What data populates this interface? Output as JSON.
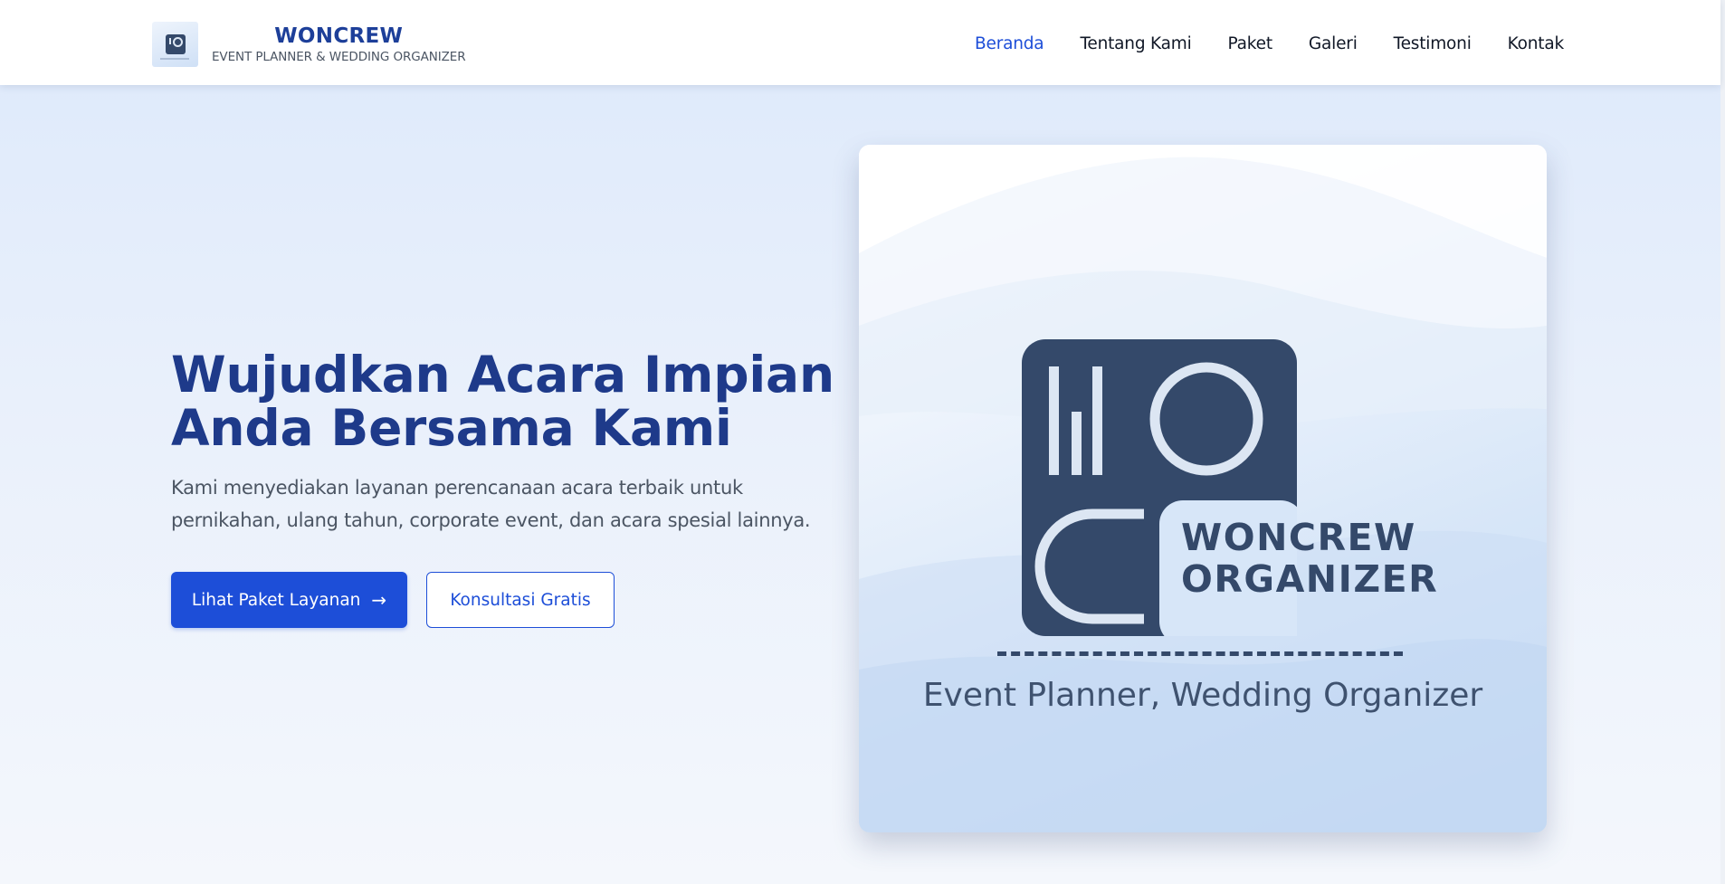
{
  "header": {
    "brand_name": "WONCREW",
    "brand_tagline": "EVENT PLANNER & WEDDING ORGANIZER",
    "nav": [
      {
        "label": "Beranda",
        "active": true
      },
      {
        "label": "Tentang Kami",
        "active": false
      },
      {
        "label": "Paket",
        "active": false
      },
      {
        "label": "Galeri",
        "active": false
      },
      {
        "label": "Testimoni",
        "active": false
      },
      {
        "label": "Kontak",
        "active": false
      }
    ]
  },
  "hero": {
    "title_line1": "Wujudkan Acara Impian",
    "title_line2": "Anda Bersama Kami",
    "description": "Kami menyediakan layanan perencanaan acara terbaik untuk pernikahan, ulang tahun, corporate event, dan acara spesial lainnya.",
    "primary_button": "Lihat Paket Layanan",
    "primary_button_icon": "arrow-right-icon",
    "secondary_button": "Konsultasi Gratis"
  },
  "hero_image": {
    "word_line1": "WONCREW",
    "word_line2": "ORGANIZER",
    "dashes": "--------------------",
    "subtitle": "Event Planner, Wedding Organizer"
  },
  "colors": {
    "primary": "#1d4ed8",
    "heading": "#1e3a8a",
    "brand": "#1d3f99",
    "logo_mark": "#34496a"
  }
}
